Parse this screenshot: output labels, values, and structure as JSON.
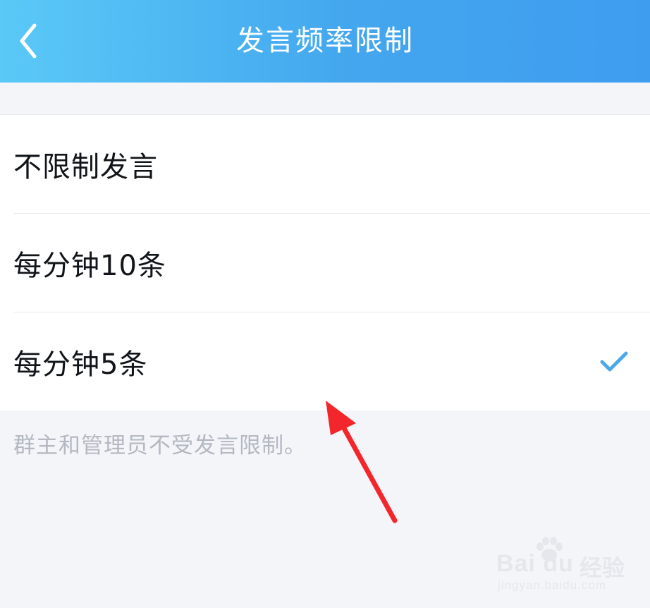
{
  "header": {
    "title": "发言频率限制",
    "back_icon": "chevron-left-icon"
  },
  "options": [
    {
      "label": "不限制发言",
      "selected": false
    },
    {
      "label": "每分钟10条",
      "selected": false
    },
    {
      "label": "每分钟5条",
      "selected": true
    }
  ],
  "footnote": "群主和管理员不受发言限制。",
  "colors": {
    "header_start": "#5ac9f7",
    "header_end": "#3f9df0",
    "check": "#4aa8e8",
    "annotation_arrow": "#f3262b"
  },
  "watermark": {
    "brand": "Bai du",
    "brand_cn": "经验",
    "url": "jingyan.baidu.com"
  }
}
